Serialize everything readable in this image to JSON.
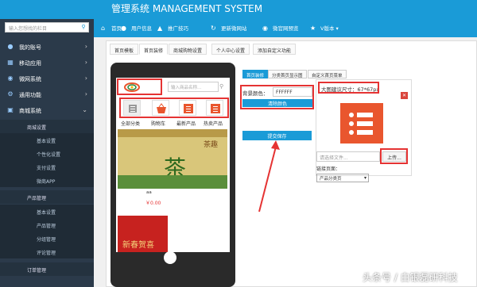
{
  "header": {
    "title": "管理系统 MANAGEMENT SYSTEM",
    "nav": [
      {
        "label": "首页",
        "icon": "home-icon"
      },
      {
        "label": "用户信息",
        "icon": "user-icon"
      },
      {
        "label": "推广技巧",
        "icon": "bullhorn-icon"
      },
      {
        "label": "更新微网站",
        "icon": "refresh-icon"
      },
      {
        "label": "微官网预览",
        "icon": "eye-icon"
      },
      {
        "label": "V版本",
        "icon": "version-icon"
      }
    ]
  },
  "sidebar": {
    "search_placeholder": "输入您想找的栏目",
    "items": [
      {
        "label": "我的账号",
        "icon": "user-icon"
      },
      {
        "label": "移动应用",
        "icon": "grid-icon"
      },
      {
        "label": "微网系统",
        "icon": "globe-icon"
      },
      {
        "label": "通用功能",
        "icon": "gear-icon"
      },
      {
        "label": "商城系统",
        "icon": "cart-icon"
      }
    ],
    "mall_sub": [
      {
        "label": "商城设置",
        "level": 1
      },
      {
        "label": "基本设置",
        "level": 2
      },
      {
        "label": "个性化设置",
        "level": 2
      },
      {
        "label": "支付设置",
        "level": 2
      },
      {
        "label": "微商APP",
        "level": 2
      },
      {
        "label": "产品管理",
        "level": 1
      },
      {
        "label": "基本设置",
        "level": 2
      },
      {
        "label": "产品管理",
        "level": 2
      },
      {
        "label": "分组管理",
        "level": 2
      },
      {
        "label": "评论管理",
        "level": 2
      },
      {
        "label": "订单管理",
        "level": 1
      }
    ]
  },
  "tabs": [
    {
      "label": "首页模板",
      "active": false
    },
    {
      "label": "首页装修",
      "active": true
    },
    {
      "label": "商城购物设置",
      "active": false
    },
    {
      "label": "个人中心设置",
      "active": false
    },
    {
      "label": "添加自定义功能",
      "active": false
    }
  ],
  "phone": {
    "search_placeholder": "输入商品名称...",
    "quick_links": [
      {
        "label": "全部分类",
        "icon": "list-icon",
        "color": "#999999"
      },
      {
        "label": "购物车",
        "icon": "basket-icon",
        "color": "#e9562e"
      },
      {
        "label": "最新产品",
        "icon": "list-icon",
        "color": "#e9562e"
      },
      {
        "label": "热卖产品",
        "icon": "list-icon",
        "color": "#e9562e"
      }
    ],
    "banner_text": "茶",
    "banner_label": "茶趣",
    "product": {
      "name": "aa",
      "price": "￥0.00"
    },
    "product2_label": "新春贺喜"
  },
  "right_panel": {
    "sub_tabs": [
      {
        "label": "首页装修",
        "active": true
      },
      {
        "label": "分类首页显示图",
        "active": false
      },
      {
        "label": "自定义首页菜单",
        "active": false
      }
    ],
    "bg_color_label": "背景颜色：",
    "bg_color_value": "FFFFFF",
    "clear_color_btn": "清除颜色",
    "submit_btn": "提交保存",
    "size_hint": "大图建议尺寸：67*67px",
    "file_placeholder": "请选择文件...",
    "upload_btn": "上传...",
    "link_label": "链接页面：",
    "link_select": "产品分类页"
  },
  "watermark": "头条号 / 白银磊研科技",
  "colors": {
    "accent": "#1a9bd7",
    "highlight": "#e53333",
    "icon": "#e9562e"
  }
}
